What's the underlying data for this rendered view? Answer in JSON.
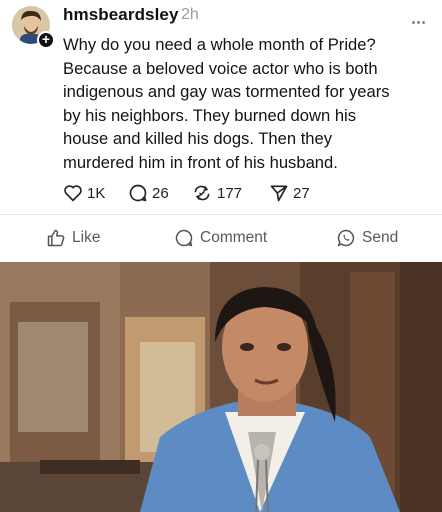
{
  "post": {
    "username": "hmsbeardsley",
    "timestamp": "2h",
    "lines": [
      "Why do you need a whole month of Pride?",
      "Because a beloved voice actor who is both",
      "indigenous and gay was tormented for years",
      "by his neighbors. They burned down his",
      "house and killed his dogs. Then they",
      "murdered him in front of his husband."
    ],
    "stats": {
      "likes": "1K",
      "comments": "26",
      "reposts": "177",
      "shares": "27"
    }
  },
  "actions": {
    "like_label": "Like",
    "comment_label": "Comment",
    "send_label": "Send"
  },
  "icons": {
    "avatar": "avatar-illustration",
    "follow": "plus-icon",
    "more": "ellipsis-icon",
    "heart": "heart-icon",
    "comment": "speech-bubble-icon",
    "repost": "repost-icon",
    "share": "paper-plane-icon",
    "like": "thumbs-up-icon",
    "send": "whatsapp-icon"
  },
  "colors": {
    "text": "#141414",
    "muted": "#9a9a9a",
    "action": "#5a5a5a",
    "divider": "#e6e6e6"
  }
}
